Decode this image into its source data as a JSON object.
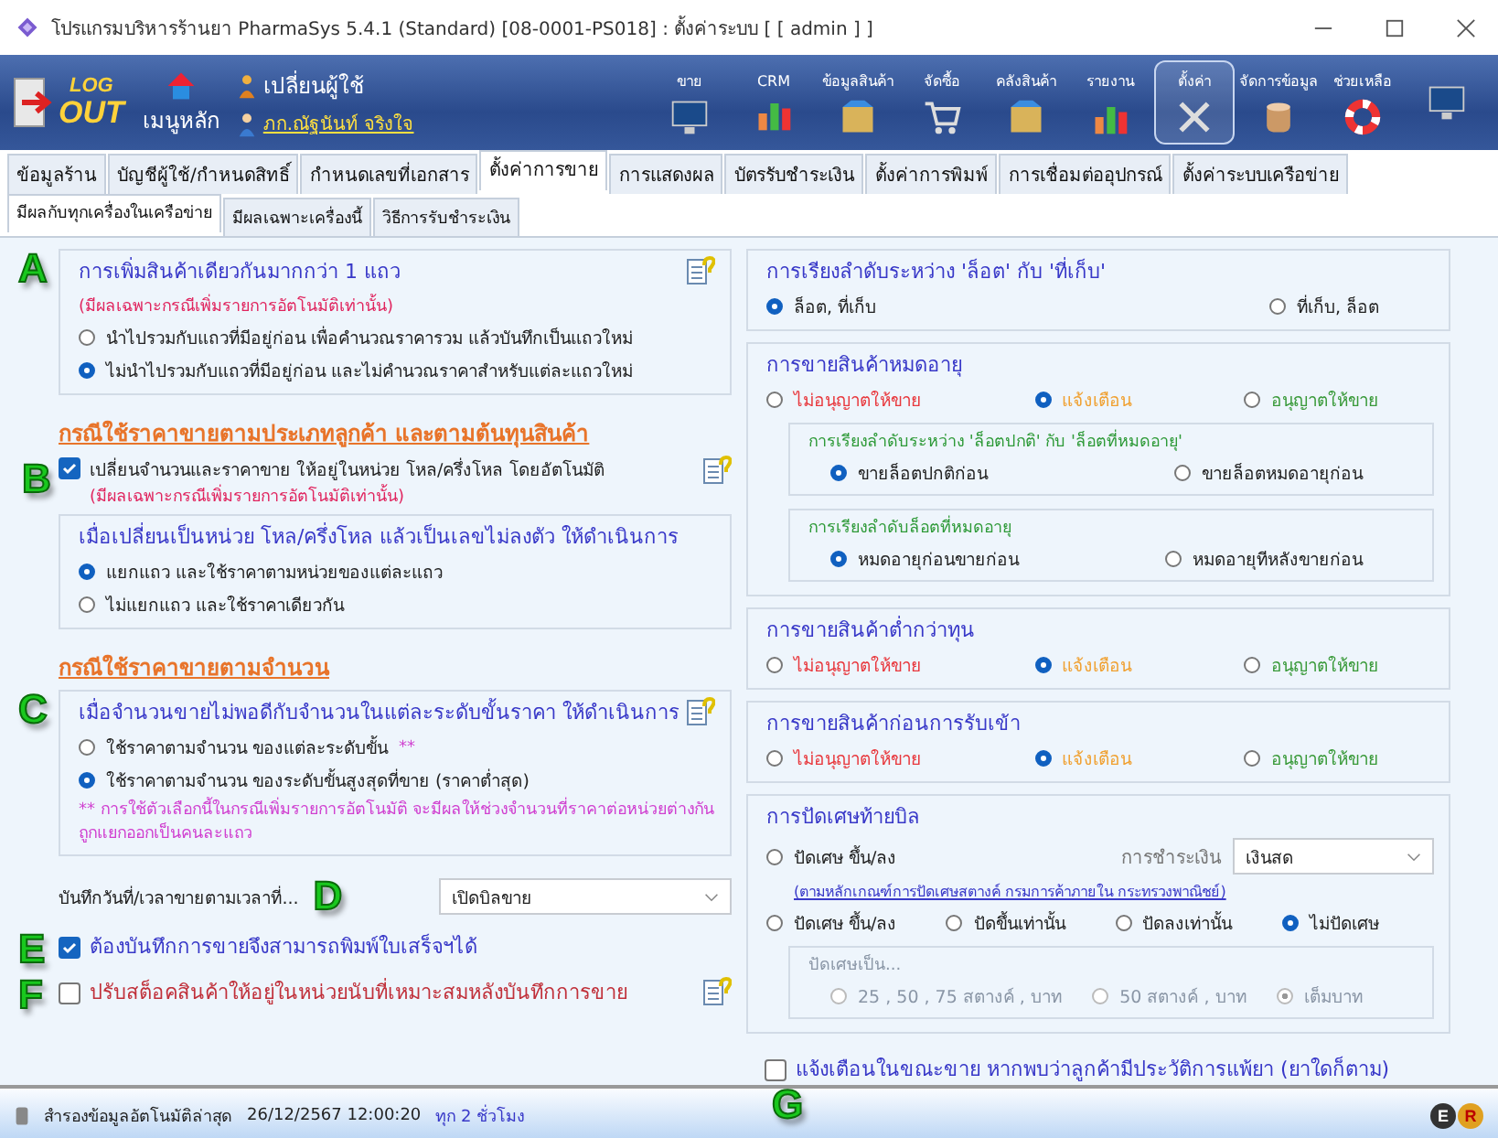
{
  "window": {
    "title": "โปรแกรมบริหารร้านยา PharmaSys 5.4.1 (Standard) [08-0001-PS018] : ตั้งค่าระบบ  [ [ admin ] ]"
  },
  "toolbar": {
    "logout": [
      "LOG",
      "OUT"
    ],
    "home": "เมนูหลัก",
    "switch_user": "เปลี่ยนผู้ใช้",
    "user": "ภก.ณัฐนันท์ จริงใจ",
    "buttons": [
      {
        "label": "ขาย",
        "kind": "monitor",
        "selected": false
      },
      {
        "label": "CRM",
        "kind": "chart",
        "selected": false
      },
      {
        "label": "ข้อมูลสินค้า",
        "kind": "box",
        "selected": false
      },
      {
        "label": "จัดซื้อ",
        "kind": "cart",
        "selected": false
      },
      {
        "label": "คลังสินค้า",
        "kind": "box",
        "selected": false
      },
      {
        "label": "รายงาน",
        "kind": "chart",
        "selected": false
      },
      {
        "label": "ตั้งค่า",
        "kind": "tools",
        "selected": true
      },
      {
        "label": "จัดการข้อมูล",
        "kind": "database",
        "selected": false
      },
      {
        "label": "ช่วยเหลือ",
        "kind": "lifebuoy",
        "selected": false
      },
      {
        "kind": "monitor",
        "selected": false
      }
    ]
  },
  "tabs": [
    {
      "label": "ข้อมูลร้าน",
      "selected": false
    },
    {
      "label": "บัญชีผู้ใช้/กำหนดสิทธิ์",
      "selected": false
    },
    {
      "label": "กำหนดเลขที่เอกสาร",
      "selected": false
    },
    {
      "label": "ตั้งค่าการขาย",
      "selected": true
    },
    {
      "label": "การแสดงผล",
      "selected": false
    },
    {
      "label": "บัตรรับชำระเงิน",
      "selected": false
    },
    {
      "label": "ตั้งค่าการพิมพ์",
      "selected": false
    },
    {
      "label": "การเชื่อมต่ออุปกรณ์",
      "selected": false
    },
    {
      "label": "ตั้งค่าระบบเครือข่าย",
      "selected": false
    }
  ],
  "subtabs": [
    {
      "label": "มีผลกับทุกเครื่องในเครือข่าย",
      "selected": true
    },
    {
      "label": "มีผลเฉพาะเครื่องนี้",
      "selected": false
    },
    {
      "label": "วิธีการรับชำระเงิน",
      "selected": false
    }
  ],
  "left": {
    "section_a": {
      "marker": "A",
      "title": "การเพิ่มสินค้าเดียวกันมากกว่า 1 แถว",
      "note": "(มีผลเฉพาะกรณีเพิ่มรายการอัตโนมัติเท่านั้น)",
      "options": [
        {
          "label": "นำไปรวมกับแถวที่มีอยู่ก่อน เพื่อคำนวณราคารวม แล้วบันทึกเป็นแถวใหม่",
          "selected": false
        },
        {
          "label": "ไม่นำไปรวมกับแถวที่มีอยู่ก่อน และไม่คำนวณราคาสำหรับแต่ละแถวใหม่",
          "selected": true
        }
      ]
    },
    "heading_1": "กรณีใช้ราคาขายตามประเภทลูกค้า และตามต้นทุนสินค้า",
    "section_b": {
      "marker": "B",
      "checked": true,
      "label": "เปลี่ยนจำนวนและราคาขาย ให้อยู่ในหน่วย โหล/ครึ่งโหล โดยอัตโนมัติ",
      "note": "(มีผลเฉพาะกรณีเพิ่มรายการอัตโนมัติเท่านั้น)",
      "group": {
        "title": "เมื่อเปลี่ยนเป็นหน่วย โหล/ครึ่งโหล แล้วเป็นเลขไม่ลงตัว ให้ดำเนินการ",
        "options": [
          {
            "label": "แยกแถว และใช้ราคาตามหน่วยของแต่ละแถว",
            "selected": true
          },
          {
            "label": "ไม่แยกแถว และใช้ราคาเดียวกัน",
            "selected": false
          }
        ]
      }
    },
    "heading_2": "กรณีใช้ราคาขายตามจำนวน",
    "section_c": {
      "marker": "C",
      "title": "เมื่อจำนวนขายไม่พอดีกับจำนวนในแต่ละระดับขั้นราคา ให้ดำเนินการ",
      "options": [
        {
          "label": "ใช้ราคาตามจำนวน ของแต่ละระดับขั้น",
          "suffix": "**",
          "selected": false
        },
        {
          "label": "ใช้ราคาตามจำนวน ของระดับขั้นสูงสุดที่ขาย (ราคาต่ำสุด)",
          "selected": true
        }
      ],
      "note": "** การใช้ตัวเลือกนี้ในกรณีเพิ่มรายการอัตโนมัติ จะมีผลให้ช่วงจำนวนที่ราคาต่อหน่วยต่างกันถูกแยกออกเป็นคนละแถว"
    },
    "sale_time": {
      "label": "บันทึกวันที่/เวลาขายตามเวลาที่...",
      "marker": "D",
      "value": "เปิดบิลขาย"
    },
    "checks": [
      {
        "marker": "E",
        "label": "ต้องบันทึกการขายจึงสามารถพิมพ์ใบเสร็จฯได้",
        "checked": true,
        "kind": "plain"
      },
      {
        "marker": "F",
        "label": "ปรับสต็อคสินค้าให้อยู่ในหน่วยนับที่เหมาะสมหลังบันทึกการขาย",
        "checked": false,
        "kind": "warning"
      }
    ]
  },
  "right": {
    "groups": [
      {
        "title": "การเรียงลำดับระหว่าง 'ล็อต' กับ 'ที่เก็บ'",
        "options": [
          {
            "label": "ล็อต, ที่เก็บ",
            "selected": true
          },
          {
            "label": "ที่เก็บ, ล็อต",
            "selected": false
          }
        ]
      },
      {
        "title": "การขายสินค้าหมดอายุ",
        "options": [
          {
            "label": "ไม่อนุญาตให้ขาย",
            "selected": false,
            "color": "#e8383d"
          },
          {
            "label": "แจ้งเตือน",
            "selected": true,
            "color": "#f0a030"
          },
          {
            "label": "อนุญาตให้ขาย",
            "selected": false,
            "color": "#3a9a3a"
          }
        ],
        "children": [
          {
            "title": "การเรียงลำดับระหว่าง 'ล็อตปกติ' กับ 'ล็อตที่หมดอายุ'",
            "options": [
              {
                "label": "ขายล็อตปกติก่อน",
                "selected": true
              },
              {
                "label": "ขายล็อตหมดอายุก่อน",
                "selected": false
              }
            ]
          },
          {
            "title": "การเรียงลำดับล็อตที่หมดอายุ",
            "options": [
              {
                "label": "หมดอายุก่อนขายก่อน",
                "selected": true
              },
              {
                "label": "หมดอายุทีหลังขายก่อน",
                "selected": false
              }
            ]
          }
        ]
      },
      {
        "title": "การขายสินค้าต่ำกว่าทุน",
        "options": [
          {
            "label": "ไม่อนุญาตให้ขาย",
            "selected": false,
            "color": "#e8383d"
          },
          {
            "label": "แจ้งเตือน",
            "selected": true,
            "color": "#f0a030"
          },
          {
            "label": "อนุญาตให้ขาย",
            "selected": false,
            "color": "#3a9a3a"
          }
        ]
      },
      {
        "title": "การขายสินค้าก่อนการรับเข้า",
        "options": [
          {
            "label": "ไม่อนุญาตให้ขาย",
            "selected": false,
            "color": "#e8383d"
          },
          {
            "label": "แจ้งเตือน",
            "selected": true,
            "color": "#f0a030"
          },
          {
            "label": "อนุญาตให้ขาย",
            "selected": false,
            "color": "#3a9a3a"
          }
        ]
      }
    ],
    "rounding": {
      "title": "การปัดเศษท้ายบิล",
      "payment_label": "การชำระเงิน",
      "payment_value": "เงินสด",
      "first": {
        "label": "ปัดเศษ ขึ้น/ลง",
        "selected": false
      },
      "link": "(ตามหลักเกณฑ์การปัดเศษสตางค์ กรมการค้าภายใน กระทรวงพาณิชย์)",
      "options": [
        {
          "label": "ปัดเศษ ขึ้น/ลง",
          "selected": false
        },
        {
          "label": "ปัดขึ้นเท่านั้น",
          "selected": false
        },
        {
          "label": "ปัดลงเท่านั้น",
          "selected": false
        },
        {
          "label": "ไม่ปัดเศษ",
          "selected": true
        }
      ],
      "sub": {
        "title": "ปัดเศษเป็น...",
        "disabled": true,
        "options": [
          {
            "label": "25 , 50 , 75 สตางค์ , บาท",
            "selected": false
          },
          {
            "label": "50 สตางค์ , บาท",
            "selected": false
          },
          {
            "label": "เต็มบาท",
            "selected": true
          }
        ]
      }
    },
    "allergy": {
      "label": "แจ้งเตือนในขณะขาย หากพบว่าลูกค้ามีประวัติการแพ้ยา (ยาใดก็ตาม)",
      "checked": false,
      "marker": "G"
    }
  },
  "status_bar": {
    "label": "สำรองข้อมูลอัตโนมัติล่าสุด",
    "time": "26/12/2567 12:00:20",
    "interval": "ทุก 2 ชั่วโมง",
    "badges": [
      "E",
      "R"
    ]
  }
}
